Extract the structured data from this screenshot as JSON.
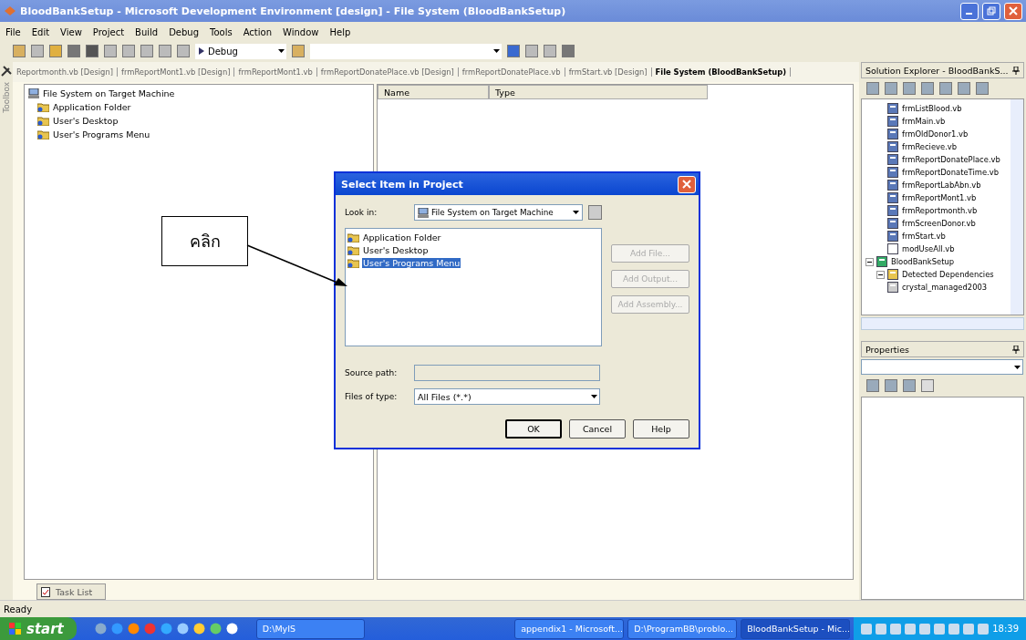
{
  "window": {
    "title": "BloodBankSetup - Microsoft Development Environment [design] - File System (BloodBankSetup)"
  },
  "menu": [
    "File",
    "Edit",
    "View",
    "Project",
    "Build",
    "Debug",
    "Tools",
    "Action",
    "Window",
    "Help"
  ],
  "toolbar": {
    "configuration": "Debug"
  },
  "toolbox": {
    "label": "Toolbox"
  },
  "doc_tabs": [
    {
      "label": "Reportmonth.vb [Design]",
      "selected": false
    },
    {
      "label": "frmReportMont1.vb [Design]",
      "selected": false
    },
    {
      "label": "frmReportMont1.vb",
      "selected": false
    },
    {
      "label": "frmReportDonatePlace.vb [Design]",
      "selected": false
    },
    {
      "label": "frmReportDonatePlace.vb",
      "selected": false
    },
    {
      "label": "frmStart.vb [Design]",
      "selected": false
    },
    {
      "label": "File System (BloodBankSetup)",
      "selected": true
    }
  ],
  "file_system": {
    "root": "File System on Target Machine",
    "children": [
      "Application Folder",
      "User's Desktop",
      "User's Programs Menu"
    ],
    "columns": [
      "Name",
      "Type"
    ]
  },
  "solution_explorer": {
    "title": "Solution Explorer - BloodBankS...",
    "items": [
      {
        "label": "frmListBlood.vb",
        "kind": "form"
      },
      {
        "label": "frmMain.vb",
        "kind": "form"
      },
      {
        "label": "frmOldDonor1.vb",
        "kind": "form"
      },
      {
        "label": "frmRecieve.vb",
        "kind": "form"
      },
      {
        "label": "frmReportDonatePlace.vb",
        "kind": "form"
      },
      {
        "label": "frmReportDonateTime.vb",
        "kind": "form"
      },
      {
        "label": "frmReportLabAbn.vb",
        "kind": "form"
      },
      {
        "label": "frmReportMont1.vb",
        "kind": "form"
      },
      {
        "label": "frmReportmonth.vb",
        "kind": "form"
      },
      {
        "label": "frmScreenDonor.vb",
        "kind": "form"
      },
      {
        "label": "frmStart.vb",
        "kind": "form"
      },
      {
        "label": "modUseAll.vb",
        "kind": "module"
      },
      {
        "label": "BloodBankSetup",
        "kind": "project",
        "expanded": true,
        "children": [
          {
            "label": "Detected Dependencies",
            "kind": "folder",
            "expanded": true,
            "children": [
              {
                "label": "crystal_managed2003",
                "kind": "dependency"
              }
            ]
          }
        ]
      }
    ]
  },
  "properties": {
    "title": "Properties"
  },
  "task_list": {
    "label": "Task List"
  },
  "status_bar": {
    "text": "Ready"
  },
  "dialog": {
    "title": "Select Item in Project",
    "look_in_label": "Look in:",
    "look_in_value": "File System on Target Machine",
    "items": [
      {
        "label": "Application Folder",
        "selected": false
      },
      {
        "label": "User's Desktop",
        "selected": false
      },
      {
        "label": "User's Programs Menu",
        "selected": true
      }
    ],
    "side_buttons": [
      {
        "label": "Add File...",
        "disabled": true
      },
      {
        "label": "Add Output...",
        "disabled": true
      },
      {
        "label": "Add Assembly...",
        "disabled": true
      }
    ],
    "source_path_label": "Source path:",
    "files_of_type_label": "Files of type:",
    "files_of_type_value": "All Files (*.*)",
    "buttons": [
      {
        "label": "OK",
        "default": true
      },
      {
        "label": "Cancel",
        "default": false
      },
      {
        "label": "Help",
        "default": false
      }
    ]
  },
  "callout": {
    "text": "คลิก"
  },
  "taskbar": {
    "start": "start",
    "windows": [
      {
        "label": "D:\\MyIS",
        "active": false
      },
      {
        "label": "appendix1 - Microsoft...",
        "active": false
      },
      {
        "label": "D:\\ProgramBB\\problo...",
        "active": false
      },
      {
        "label": "BloodBankSetup - Mic...",
        "active": true
      }
    ],
    "clock": "18:39"
  }
}
